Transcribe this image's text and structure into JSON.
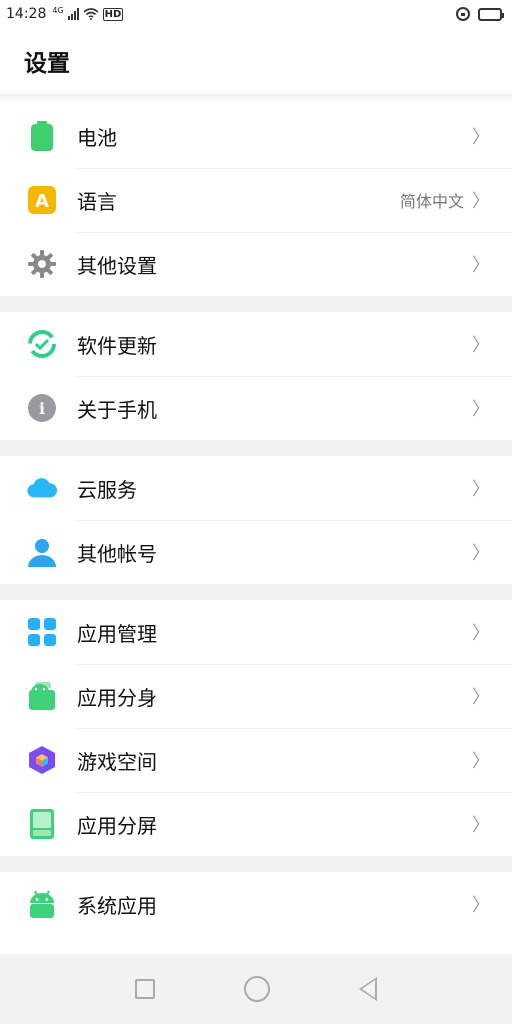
{
  "status_bar": {
    "time": "14:28",
    "network": "4G",
    "hd_label": "HD"
  },
  "header": {
    "title": "设置"
  },
  "groups": [
    {
      "items": [
        {
          "label": "电池",
          "icon": "battery-icon",
          "value": ""
        },
        {
          "label": "语言",
          "icon": "language-icon",
          "value": "简体中文"
        },
        {
          "label": "其他设置",
          "icon": "gear-icon",
          "value": ""
        }
      ]
    },
    {
      "items": [
        {
          "label": "软件更新",
          "icon": "update-icon",
          "value": ""
        },
        {
          "label": "关于手机",
          "icon": "info-icon",
          "value": ""
        }
      ]
    },
    {
      "items": [
        {
          "label": "云服务",
          "icon": "cloud-icon",
          "value": ""
        },
        {
          "label": "其他帐号",
          "icon": "person-icon",
          "value": ""
        }
      ]
    },
    {
      "items": [
        {
          "label": "应用管理",
          "icon": "grid-icon",
          "value": ""
        },
        {
          "label": "应用分身",
          "icon": "android-clone-icon",
          "value": ""
        },
        {
          "label": "游戏空间",
          "icon": "game-cube-icon",
          "value": ""
        },
        {
          "label": "应用分屏",
          "icon": "split-screen-icon",
          "value": ""
        }
      ]
    },
    {
      "items": [
        {
          "label": "系统应用",
          "icon": "android-icon",
          "value": ""
        }
      ]
    }
  ],
  "chevron": "〉",
  "icon_label_A": "A",
  "icon_label_i": "i",
  "colors": {
    "battery": "#3ecf6e",
    "language": "#f5b800",
    "gear": "#8a8a8a",
    "update": "#2fcf88",
    "info": "#9a9aa0",
    "cloud": "#29b6f6",
    "person": "#2aa7ee",
    "grid": "#27b0f5",
    "android": "#3fd07a",
    "game": "#7b4df0",
    "split": "#3fd07a"
  }
}
